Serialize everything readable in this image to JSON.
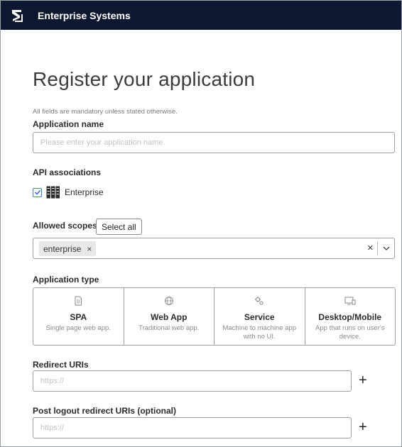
{
  "header": {
    "brand": "Enterprise Systems"
  },
  "page": {
    "title": "Register your application",
    "mandatory_note": "All fields are mandatory unless stated otherwise."
  },
  "app_name": {
    "label": "Application name",
    "placeholder": "Please enter your application name."
  },
  "api_associations": {
    "label": "API associations",
    "items": [
      {
        "label": "Enterprise",
        "checked": true
      }
    ]
  },
  "scopes": {
    "label": "Allowed scopes",
    "select_all": "Select all",
    "selected": [
      {
        "label": "enterprise",
        "remove": "×"
      }
    ],
    "clear": "×"
  },
  "app_type": {
    "label": "Application type",
    "options": [
      {
        "title": "SPA",
        "desc": "Single page web app.",
        "icon": "document-icon"
      },
      {
        "title": "Web App",
        "desc": "Traditional web app.",
        "icon": "globe-icon"
      },
      {
        "title": "Service",
        "desc": "Machine to machine app with no UI.",
        "icon": "gears-icon"
      },
      {
        "title": "Desktop/Mobile",
        "desc": "App that runs on user's device.",
        "icon": "devices-icon"
      }
    ]
  },
  "redirect": {
    "label": "Redirect URIs",
    "placeholder": "https://",
    "add": "+"
  },
  "logout_redirect": {
    "label": "Post logout redirect URIs (optional)",
    "placeholder": "https://",
    "add": "+"
  }
}
